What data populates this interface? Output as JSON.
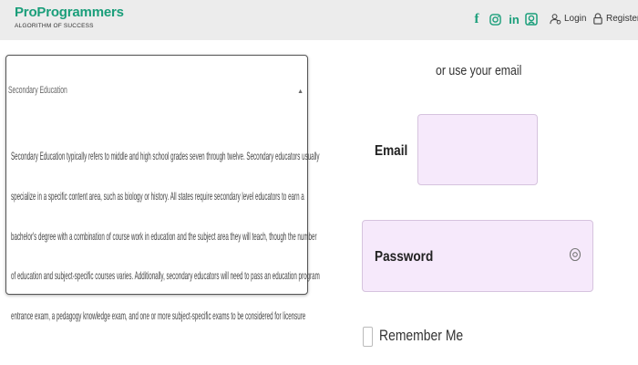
{
  "header": {
    "brand": "ProProgrammers",
    "tagline": "ALGORITHM OF SUCCESS",
    "social_icons": [
      "facebook-icon",
      "instagram-icon",
      "linkedin-icon",
      "github-icon"
    ],
    "login_label": "Login",
    "register_label": "Register",
    "brand_color": "#1a9e7a"
  },
  "accordion": {
    "title": "Secondary Education",
    "body_lines": [
      "Secondary Education typically refers to middle and high school grades seven through twelve. Secondary educators usually",
      "specialize in a specific content area, such as biology or history. All states require secondary level educators to earn a",
      "bachelor's degree with a combination of course work in education and the subject area they will teach, though the number",
      "of education and subject-specific courses varies. Additionally, secondary educators will need to pass an education program",
      "entrance exam, a pedagogy knowledge exam, and one or more subject-specific exams to be considered for licensure"
    ]
  },
  "form": {
    "heading": "or use your email",
    "email_label": "Email",
    "email_value": "",
    "password_label": "Password",
    "remember_label": "Remember Me",
    "input_bg": "#f6e9fb"
  }
}
